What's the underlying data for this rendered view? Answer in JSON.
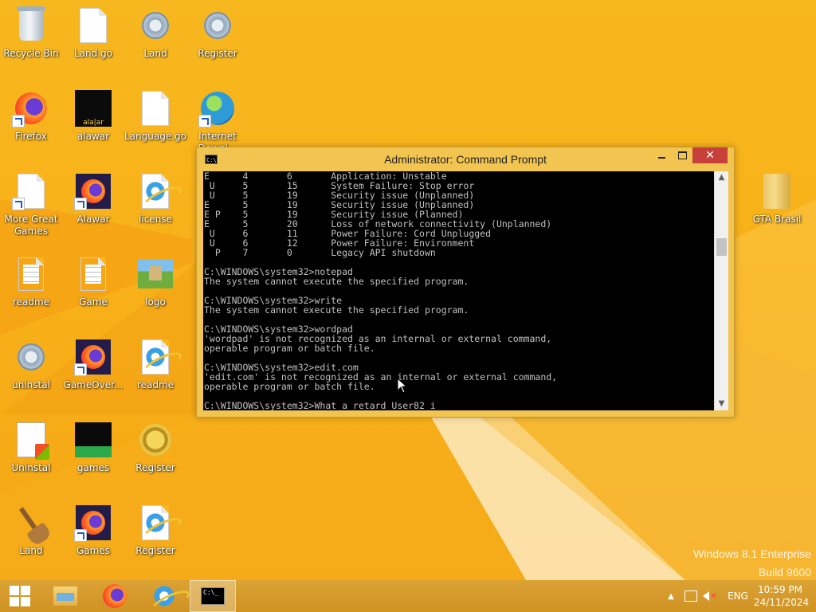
{
  "desktop": {
    "icons": [
      {
        "label": "Recycle Bin",
        "icon": "recycle-bin-icon"
      },
      {
        "label": "Land.go",
        "icon": "document-icon"
      },
      {
        "label": "Land",
        "icon": "settings-file-icon"
      },
      {
        "label": "Register",
        "icon": "settings-file-icon"
      },
      {
        "label": "Firefox",
        "icon": "firefox-icon"
      },
      {
        "label": "alawar",
        "icon": "alawar-icon"
      },
      {
        "label": "Language.go",
        "icon": "document-icon"
      },
      {
        "label": "Internet Downl...",
        "icon": "internet-download-icon"
      },
      {
        "label": "More Great Games",
        "icon": "document-icon"
      },
      {
        "label": "Alawar",
        "icon": "firefox-icon"
      },
      {
        "label": "license",
        "icon": "internet-explorer-icon"
      },
      {
        "label": "GTA Brasil",
        "icon": "folder-icon"
      },
      {
        "label": "readme",
        "icon": "text-file-icon"
      },
      {
        "label": "Game",
        "icon": "text-file-icon"
      },
      {
        "label": "logo",
        "icon": "image-file-icon"
      },
      {
        "label": "uninstal",
        "icon": "settings-file-icon"
      },
      {
        "label": "GameOver...",
        "icon": "firefox-icon"
      },
      {
        "label": "readme",
        "icon": "internet-explorer-icon"
      },
      {
        "label": "Uninstal",
        "icon": "uninstaller-icon"
      },
      {
        "label": "games",
        "icon": "games-icon"
      },
      {
        "label": "Register",
        "icon": "coins-icon"
      },
      {
        "label": "Land",
        "icon": "broom-icon"
      },
      {
        "label": "Games",
        "icon": "firefox-icon"
      },
      {
        "label": "Register",
        "icon": "internet-explorer-icon"
      }
    ]
  },
  "cmd_window": {
    "title": "Administrator: Command Prompt",
    "icon_text": "C:\\",
    "buttons": {
      "minimize": "minimize",
      "maximize": "maximize",
      "close": "✕"
    },
    "console_text": "E      4       6       Application: Unstable\n U     5       15      System Failure: Stop error\n U     5       19      Security issue (Unplanned)\nE      5       19      Security issue (Unplanned)\nE P    5       19      Security issue (Planned)\nE      5       20      Loss of network connectivity (Unplanned)\n U     6       11      Power Failure: Cord Unplugged\n U     6       12      Power Failure: Environment\n  P    7       0       Legacy API shutdown\n\nC:\\WINDOWS\\system32>notepad\nThe system cannot execute the specified program.\n\nC:\\WINDOWS\\system32>write\nThe system cannot execute the specified program.\n\nC:\\WINDOWS\\system32>wordpad\n'wordpad' is not recognized as an internal or external command,\noperable program or batch file.\n\nC:\\WINDOWS\\system32>edit.com\n'edit.com' is not recognized as an internal or external command,\noperable program or batch file.\n\nC:\\WINDOWS\\system32>What a retard User82 i",
    "scroll_up": "▲",
    "scroll_down": "▼"
  },
  "watermark": {
    "line1": "Windows 8.1 Enterprise",
    "line2": "Build 9600"
  },
  "taskbar": {
    "start_icon": "windows-start-icon",
    "pinned": [
      "file-explorer-icon",
      "firefox-icon",
      "internet-explorer-icon",
      "command-prompt-icon"
    ],
    "cmd_icon_text": "C:\\_",
    "tray": {
      "arrow": "▲",
      "language": "ENG",
      "time": "10:59 PM",
      "date": "24/11/2024"
    }
  },
  "colors": {
    "wallpaper": "#f7b71e",
    "taskbar": "#d79b2a",
    "close_button": "#c7403a",
    "console_bg": "#000000",
    "console_fg": "#c0c0c0"
  }
}
